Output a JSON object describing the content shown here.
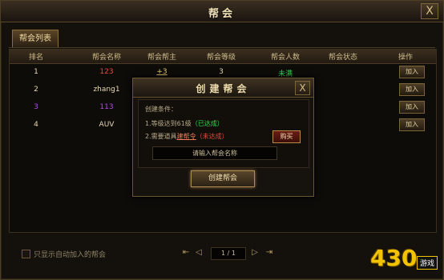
{
  "window": {
    "title": "帮会",
    "close_label": "X"
  },
  "tabs": [
    {
      "label": "帮会列表"
    }
  ],
  "table": {
    "headers": [
      "排名",
      "帮会名称",
      "帮会帮主",
      "帮会等级",
      "帮会人数",
      "帮会状态",
      "操作"
    ],
    "rows": [
      {
        "rank": "1",
        "name": "123",
        "leader": "+3",
        "level": "3",
        "members": "未满",
        "status": "",
        "action": "加入"
      },
      {
        "rank": "2",
        "name": "zhang1",
        "leader": "",
        "level": "",
        "members": "",
        "status": "",
        "action": "加入"
      },
      {
        "rank": "3",
        "name": "113",
        "leader": "",
        "level": "",
        "members": "",
        "status": "",
        "action": "加入"
      },
      {
        "rank": "4",
        "name": "AUV",
        "leader": "",
        "level": "",
        "members": "",
        "status": "",
        "action": "加入"
      }
    ]
  },
  "modal": {
    "title": "创建帮会",
    "close_label": "X",
    "condition_label": "创建条件：",
    "req1": "1.等级达到61级",
    "req1_state": "（已达成）",
    "req2_prefix": "2.需要道具",
    "req2_item": "建帮令",
    "req2_state": "（未达成）",
    "buy_label": "购买",
    "input_placeholder": "请输入帮会名称",
    "create_label": "创建帮会"
  },
  "footer": {
    "checkbox_label": "只显示自动加入的帮会",
    "page": "1 / 1",
    "first": "⇤",
    "prev": "◁",
    "next": "▷",
    "last": "⇥"
  },
  "watermark": {
    "text": "430",
    "tag": "游戏"
  },
  "colors": {
    "rank_1": "#e8d9b0",
    "name_1": "#e84a3a",
    "name_2": "#e8d9b0",
    "name_3": "#b24ce8",
    "name_4": "#e8d9b0",
    "leader_1": "#e8c86a",
    "members_1": "#33d84f",
    "done": "#2fd84b",
    "pending": "#e14a3a",
    "item_link": "#f07a5a"
  }
}
